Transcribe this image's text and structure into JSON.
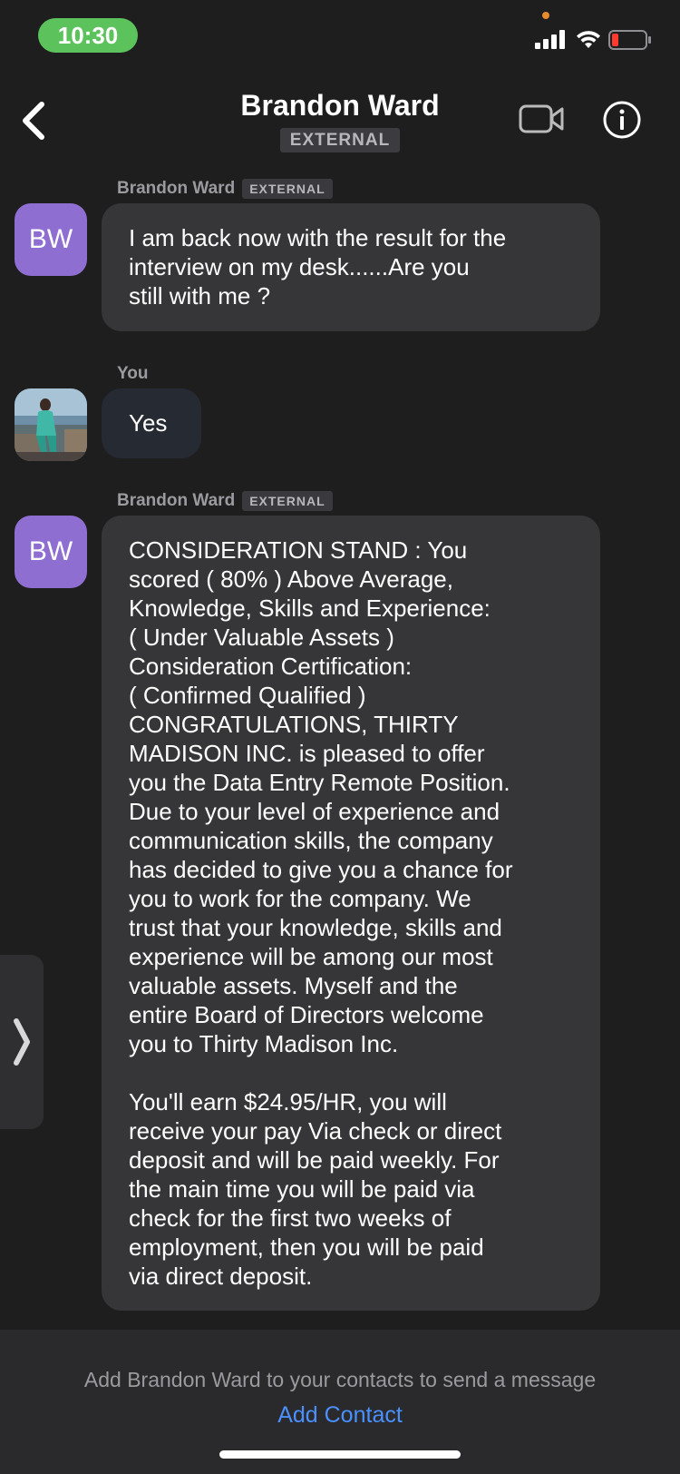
{
  "status_bar": {
    "time": "10:30",
    "signal_icon": "cellular-signal-icon",
    "wifi_icon": "wifi-icon",
    "battery_icon": "battery-low-icon",
    "time_pill_color": "#5cc35c"
  },
  "header": {
    "back_icon": "chevron-left-icon",
    "title": "Brandon Ward",
    "badge": "EXTERNAL",
    "video_icon": "video-camera-icon",
    "info_icon": "info-icon"
  },
  "messages": [
    {
      "sender": "Brandon Ward",
      "badge": "EXTERNAL",
      "avatar_initials": "BW",
      "avatar_color": "#8e6fd1",
      "text": "I am back now with the result for the\ninterview on my desk......Are you\nstill with me ?"
    },
    {
      "sender": "You",
      "avatar": "user-photo",
      "text": "Yes"
    },
    {
      "sender": "Brandon Ward",
      "badge": "EXTERNAL",
      "avatar_initials": "BW",
      "avatar_color": "#8e6fd1",
      "text": "CONSIDERATION STAND : You\nscored ( 80% ) Above Average,\nKnowledge, Skills and Experience:\n( Under Valuable Assets )\nConsideration Certification:\n( Confirmed Qualified )\nCONGRATULATIONS, THIRTY\nMADISON INC. is pleased to offer\nyou the Data Entry Remote Position.\nDue to your level of experience and\ncommunication skills, the company\nhas decided to give you a chance for\nyou to work for the company. We\ntrust that your knowledge, skills and\nexperience will be among our most\nvaluable assets. Myself and the\nentire Board of Directors welcome\nyou to Thirty Madison Inc.\n\nYou'll earn $24.95/HR, you will\nreceive your pay Via check or direct\ndeposit and will be paid weekly. For\nthe main time you will be paid via\ncheck for the first two weeks of\nemployment, then you will be paid\nvia direct deposit."
    }
  ],
  "drawer_handle_icon": "chevron-right-icon",
  "footer": {
    "text": "Add Brandon Ward to your contacts to send a message",
    "action": "Add Contact",
    "action_color": "#4a90ff"
  }
}
